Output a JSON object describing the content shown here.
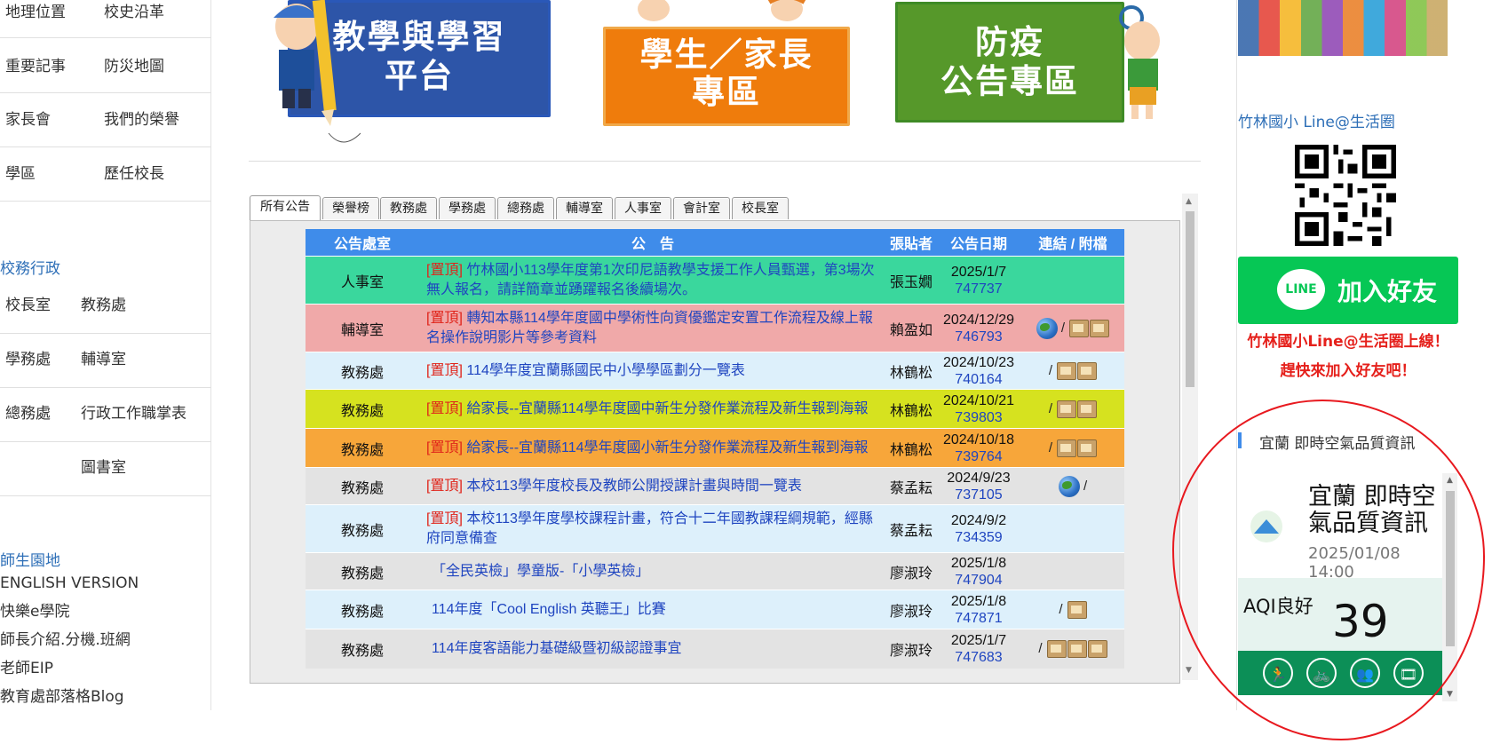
{
  "sidebar": {
    "intro_rows": [
      [
        "地理位置",
        "校史沿革"
      ],
      [
        "重要記事",
        "防災地圖"
      ],
      [
        "家長會",
        "我們的榮譽"
      ],
      [
        "學區",
        "歷任校長"
      ]
    ],
    "admin_title": "校務行政",
    "admin_rows": [
      [
        "校長室",
        "教務處"
      ],
      [
        "學務處",
        "輔導室"
      ],
      [
        "總務處",
        "行政工作職掌表"
      ],
      [
        "",
        "圖書室"
      ]
    ],
    "campus_title": "師生園地",
    "links": [
      "ENGLISH VERSION",
      "快樂e學院",
      "師長介紹.分機.班網",
      "老師EIP",
      "教育處部落格Blog"
    ]
  },
  "banners": [
    {
      "text": "教學與學習平台",
      "line1": "教學與學習",
      "line2": "平台"
    },
    {
      "text": "學生／家長專區",
      "line1": "學生／家長",
      "line2": "專區"
    },
    {
      "text": "防疫公告專區",
      "line1": "防疫",
      "line2": "公告專區"
    }
  ],
  "tabs": [
    "所有公告",
    "榮譽榜",
    "教務處",
    "學務處",
    "總務處",
    "輔導室",
    "人事室",
    "會計室",
    "校長室"
  ],
  "table": {
    "headers": [
      "公告處室",
      "公　告",
      "張貼者",
      "公告日期",
      "連結 / 附檔"
    ],
    "pinned_tag": "[置頂]",
    "rows": [
      {
        "office": "人事室",
        "pinned": true,
        "title": "竹林國小113學年度第1次印尼語教學支援工作人員甄選，第3場次無人報名，請詳簡章並踴躍報名後續場次。",
        "author": "張玉嫺",
        "date": "2025/1/7",
        "hits": "747737",
        "link_sep": "",
        "bg": "#3ad79d"
      },
      {
        "office": "輔導室",
        "pinned": true,
        "title": "轉知本縣114學年度國中學術性向資優鑑定安置工作流程及線上報名操作說明影片等參考資料",
        "author": "賴盈如",
        "date": "2024/12/29",
        "hits": "746793",
        "link_sep": "/",
        "bg": "#f0a9a9"
      },
      {
        "office": "教務處",
        "pinned": true,
        "title": "114學年度宜蘭縣國民中小學學區劃分一覽表",
        "author": "林鶴松",
        "date": "2024/10/23",
        "hits": "740164",
        "link_sep": "/",
        "bg": "#ddf0fb"
      },
      {
        "office": "教務處",
        "pinned": true,
        "title": "給家長--宜蘭縣114學年度國中新生分發作業流程及新生報到海報",
        "author": "林鶴松",
        "date": "2024/10/21",
        "hits": "739803",
        "link_sep": "/",
        "bg": "#d6e21f"
      },
      {
        "office": "教務處",
        "pinned": true,
        "title": "給家長--宜蘭縣114學年度國小新生分發作業流程及新生報到海報",
        "author": "林鶴松",
        "date": "2024/10/18",
        "hits": "739764",
        "link_sep": "/",
        "bg": "#f7a63a"
      },
      {
        "office": "教務處",
        "pinned": true,
        "title": "本校113學年度校長及教師公開授課計畫與時間一覽表",
        "author": "蔡孟耘",
        "date": "2024/9/23",
        "hits": "737105",
        "link_sep": "/",
        "bg": "#e3e3e3"
      },
      {
        "office": "教務處",
        "pinned": true,
        "title": "本校113學年度學校課程計畫，符合十二年國教課程綱規範，經縣府同意備查",
        "author": "蔡孟耘",
        "date": "2024/9/2",
        "hits": "734359",
        "link_sep": "",
        "bg": "#ddf0fb"
      },
      {
        "office": "教務處",
        "pinned": false,
        "title": "「全民英檢」學童版-「小學英檢」",
        "author": "廖淑玲",
        "date": "2025/1/8",
        "hits": "747904",
        "link_sep": "",
        "bg": "#e3e3e3"
      },
      {
        "office": "教務處",
        "pinned": false,
        "title": "114年度「Cool English 英聽王」比賽",
        "author": "廖淑玲",
        "date": "2025/1/8",
        "hits": "747871",
        "link_sep": "/",
        "bg": "#ddf0fb"
      },
      {
        "office": "教務處",
        "pinned": false,
        "title": "114年度客語能力基礎級暨初級認證事宜",
        "author": "廖淑玲",
        "date": "2025/1/7",
        "hits": "747683",
        "link_sep": "/",
        "bg": "#e3e3e3"
      }
    ]
  },
  "right": {
    "line_title": "竹林國小 Line@生活圈",
    "line_button": "加入好友",
    "line_logo": "LINE",
    "promo_line1": "竹林國小Line@生活圈上線！",
    "promo_line2": "趕快來加入好友吧！",
    "aq_section_title": "宜蘭 即時空氣品質資訊",
    "aq_card_title": "宜蘭 即時空氣品質資訊",
    "aq_time": "2025/01/08 14:00",
    "aqi_label": "AQI良好",
    "aqi_value": "39",
    "aq_icons": [
      "running-icon",
      "bicycle-icon",
      "group-icon",
      "film-icon"
    ]
  },
  "colors": {
    "header_blue": "#3f8cea",
    "link_blue": "#1f45c0",
    "pin_red": "#e0241a",
    "line_green": "#06c755",
    "annotation_red": "#e8191f",
    "aq_green": "#0c8f57"
  }
}
